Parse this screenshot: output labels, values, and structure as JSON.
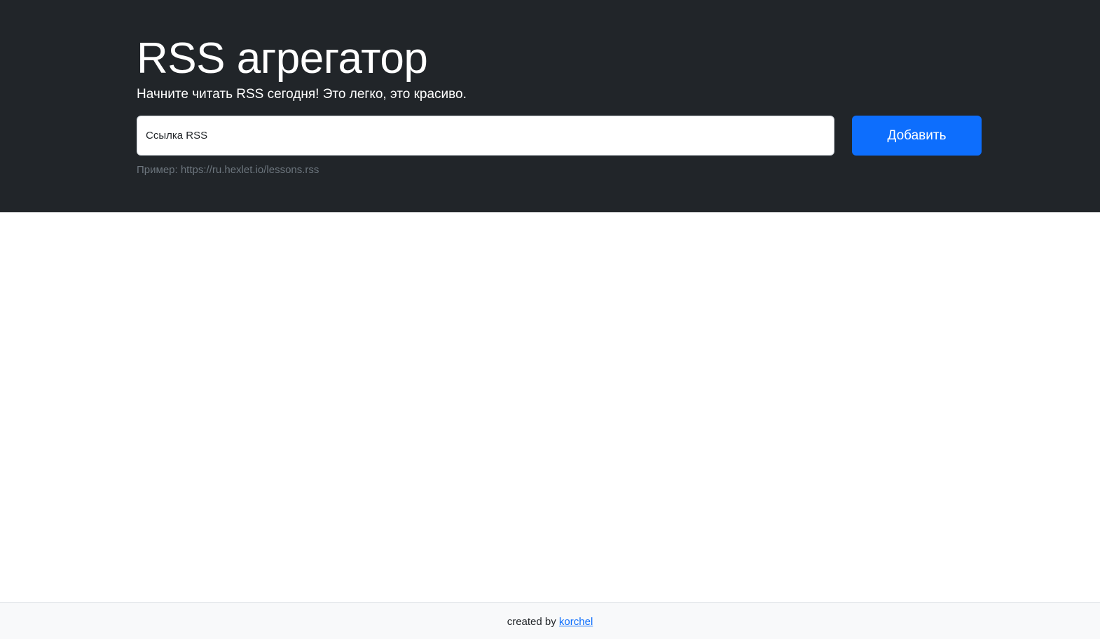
{
  "hero": {
    "title": "RSS агрегатор",
    "lead": "Начните читать RSS сегодня! Это легко, это красиво.",
    "form": {
      "input_placeholder": "Ссылка RSS",
      "input_value": "",
      "add_button_label": "Добавить",
      "example_text": "Пример: https://ru.hexlet.io/lessons.rss"
    }
  },
  "footer": {
    "prefix": "created by",
    "author_link_label": "korchel"
  },
  "colors": {
    "hero_background": "#212529",
    "primary_button": "#0d6efd",
    "muted_text": "#6c757d",
    "footer_background": "#f8f9fa"
  }
}
